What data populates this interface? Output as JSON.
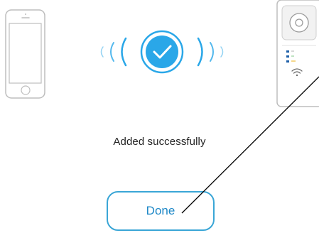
{
  "status": {
    "message": "Added successfully"
  },
  "actions": {
    "done_label": "Done"
  },
  "icons": {
    "phone": "smartphone-icon",
    "signal_left": "wireless-signal-left-icon",
    "success": "checkmark-circle-icon",
    "signal_right": "wireless-signal-right-icon",
    "device": "doorbell-camera-icon",
    "wifi": "wifi-icon"
  },
  "colors": {
    "accent": "#2aa7e8",
    "button_border": "#3aa6d6",
    "button_text": "#1e88c7",
    "text": "#222222",
    "outline": "#bdbdbd"
  }
}
